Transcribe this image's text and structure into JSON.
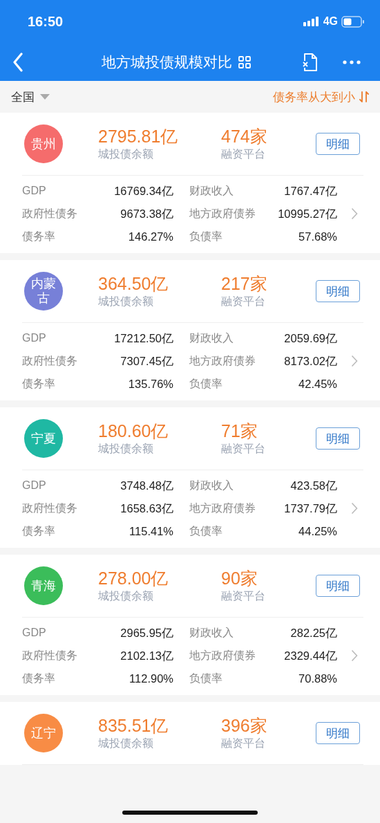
{
  "status_bar": {
    "time": "16:50",
    "network": "4G"
  },
  "nav": {
    "title": "地方城投债规模对比"
  },
  "filter": {
    "region": "全国",
    "sort": "债务率从大到小"
  },
  "regions": [
    {
      "name": "贵州",
      "color": "#f56c6c",
      "balance": "2795.81亿",
      "balance_label": "城投债余额",
      "platforms": "474家",
      "platforms_label": "融资平台",
      "button": "明细",
      "stats": [
        {
          "label": "GDP",
          "value": "16769.34亿",
          "label2": "财政收入",
          "value2": "1767.47亿"
        },
        {
          "label": "政府性债务",
          "value": "9673.38亿",
          "label2": "地方政府债券",
          "value2": "10995.27亿"
        },
        {
          "label": "债务率",
          "value": "146.27%",
          "label2": "负债率",
          "value2": "57.68%"
        }
      ]
    },
    {
      "name": "内蒙古",
      "color": "#7780d8",
      "balance": "364.50亿",
      "balance_label": "城投债余额",
      "platforms": "217家",
      "platforms_label": "融资平台",
      "button": "明细",
      "stats": [
        {
          "label": "GDP",
          "value": "17212.50亿",
          "label2": "财政收入",
          "value2": "2059.69亿"
        },
        {
          "label": "政府性债务",
          "value": "7307.45亿",
          "label2": "地方政府债券",
          "value2": "8173.02亿"
        },
        {
          "label": "债务率",
          "value": "135.76%",
          "label2": "负债率",
          "value2": "42.45%"
        }
      ]
    },
    {
      "name": "宁夏",
      "color": "#1fb8a3",
      "balance": "180.60亿",
      "balance_label": "城投债余额",
      "platforms": "71家",
      "platforms_label": "融资平台",
      "button": "明细",
      "stats": [
        {
          "label": "GDP",
          "value": "3748.48亿",
          "label2": "财政收入",
          "value2": "423.58亿"
        },
        {
          "label": "政府性债务",
          "value": "1658.63亿",
          "label2": "地方政府债券",
          "value2": "1737.79亿"
        },
        {
          "label": "债务率",
          "value": "115.41%",
          "label2": "负债率",
          "value2": "44.25%"
        }
      ]
    },
    {
      "name": "青海",
      "color": "#3bbd5a",
      "balance": "278.00亿",
      "balance_label": "城投债余额",
      "platforms": "90家",
      "platforms_label": "融资平台",
      "button": "明细",
      "stats": [
        {
          "label": "GDP",
          "value": "2965.95亿",
          "label2": "财政收入",
          "value2": "282.25亿"
        },
        {
          "label": "政府性债务",
          "value": "2102.13亿",
          "label2": "地方政府债券",
          "value2": "2329.44亿"
        },
        {
          "label": "债务率",
          "value": "112.90%",
          "label2": "负债率",
          "value2": "70.88%"
        }
      ]
    },
    {
      "name": "辽宁",
      "color": "#f88c45",
      "balance": "835.51亿",
      "balance_label": "城投债余额",
      "platforms": "396家",
      "platforms_label": "融资平台",
      "button": "明细"
    }
  ]
}
